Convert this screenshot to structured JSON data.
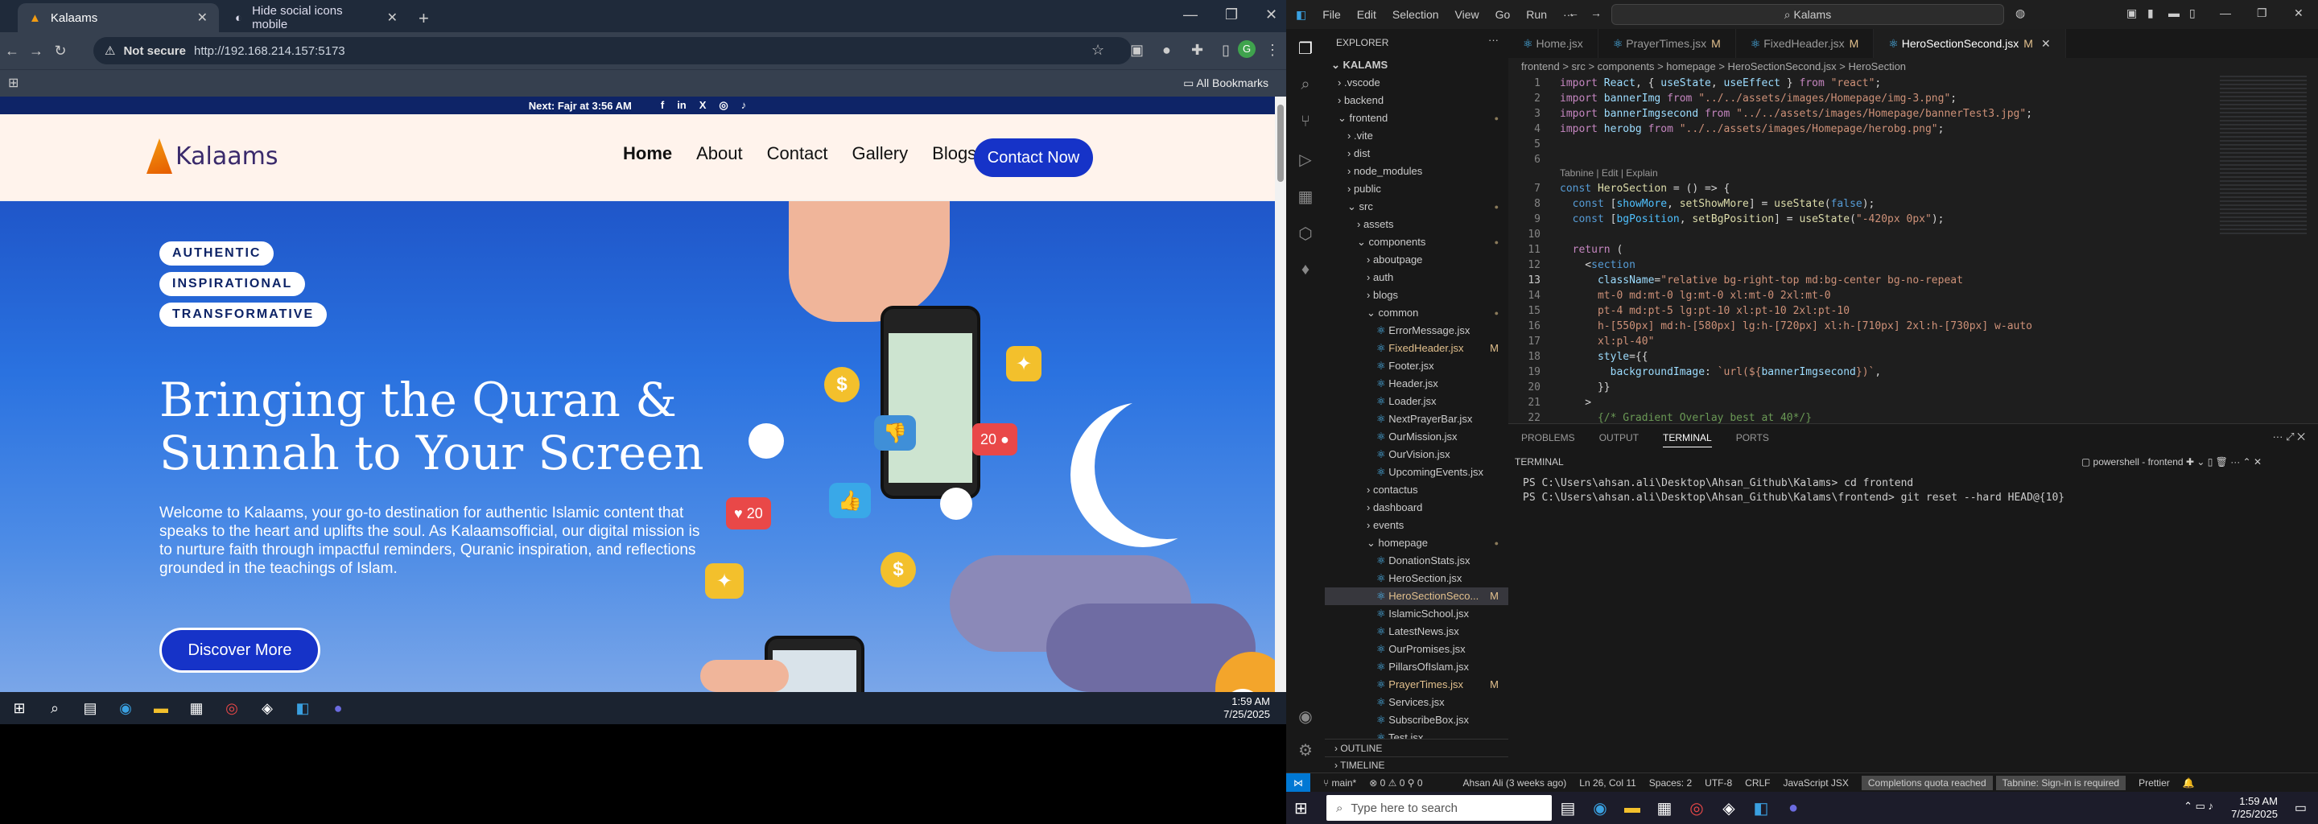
{
  "browser": {
    "tabs": [
      {
        "title": "Kalaams"
      },
      {
        "title": "Hide social icons mobile"
      }
    ],
    "new_tab": "+",
    "not_secure": "Not secure",
    "url": "http://192.168.214.157:5173",
    "all_bookmarks": "All Bookmarks"
  },
  "site": {
    "topbar_text": "Next: Fajr at 3:56 AM",
    "social": [
      "f",
      "in",
      "X",
      "◎",
      "♪"
    ],
    "logo_text": "Kalaams",
    "menu": [
      "Home",
      "About",
      "Contact",
      "Gallery",
      "Blogs"
    ],
    "contact_button": "Contact Now",
    "pills": [
      "AUTHENTIC",
      "INSPIRATIONAL",
      "TRANSFORMATIVE"
    ],
    "hero_title": "Bringing the Quran & Sunnah to Your Screen",
    "hero_para": "Welcome to Kalaams, your go-to destination for authentic Islamic content that speaks to the heart and uplifts the soul. As Kalaamsofficial, our digital mission is to nurture faith through impactful reminders, Quranic inspiration, and reflections grounded in the teachings of Islam.",
    "discover_button": "Discover More",
    "badges": {
      "comments": "20",
      "likes": "20",
      "coin": "$"
    }
  },
  "inner_taskbar": {
    "time": "1:59 AM",
    "date": "7/25/2025"
  },
  "vscode": {
    "menu": [
      "File",
      "Edit",
      "Selection",
      "View",
      "Go",
      "Run",
      "···"
    ],
    "search": "Kalams",
    "explorer_title": "EXPLORER",
    "root": "KALAMS",
    "tree": [
      {
        "label": ".vscode",
        "indent": 1,
        "folder": true
      },
      {
        "label": "backend",
        "indent": 1,
        "folder": true
      },
      {
        "label": "frontend",
        "indent": 1,
        "folder": true,
        "open": true,
        "dot": true
      },
      {
        "label": ".vite",
        "indent": 2,
        "folder": true
      },
      {
        "label": "dist",
        "indent": 2,
        "folder": true
      },
      {
        "label": "node_modules",
        "indent": 2,
        "folder": true
      },
      {
        "label": "public",
        "indent": 2,
        "folder": true
      },
      {
        "label": "src",
        "indent": 2,
        "folder": true,
        "open": true,
        "dot": true
      },
      {
        "label": "assets",
        "indent": 3,
        "folder": true
      },
      {
        "label": "components",
        "indent": 3,
        "folder": true,
        "open": true,
        "dot": true
      },
      {
        "label": "aboutpage",
        "indent": 4,
        "folder": true
      },
      {
        "label": "auth",
        "indent": 4,
        "folder": true
      },
      {
        "label": "blogs",
        "indent": 4,
        "folder": true
      },
      {
        "label": "common",
        "indent": 4,
        "folder": true,
        "open": true,
        "dot": true
      },
      {
        "label": "ErrorMessage.jsx",
        "indent": 5
      },
      {
        "label": "FixedHeader.jsx",
        "indent": 5,
        "mod": "M"
      },
      {
        "label": "Footer.jsx",
        "indent": 5
      },
      {
        "label": "Header.jsx",
        "indent": 5
      },
      {
        "label": "Loader.jsx",
        "indent": 5
      },
      {
        "label": "NextPrayerBar.jsx",
        "indent": 5
      },
      {
        "label": "OurMission.jsx",
        "indent": 5
      },
      {
        "label": "OurVision.jsx",
        "indent": 5
      },
      {
        "label": "UpcomingEvents.jsx",
        "indent": 5
      },
      {
        "label": "contactus",
        "indent": 4,
        "folder": true
      },
      {
        "label": "dashboard",
        "indent": 4,
        "folder": true
      },
      {
        "label": "events",
        "indent": 4,
        "folder": true
      },
      {
        "label": "homepage",
        "indent": 4,
        "folder": true,
        "open": true,
        "dot": true
      },
      {
        "label": "DonationStats.jsx",
        "indent": 5
      },
      {
        "label": "HeroSection.jsx",
        "indent": 5
      },
      {
        "label": "HeroSectionSeco...",
        "indent": 5,
        "mod": "M",
        "sel": true
      },
      {
        "label": "IslamicSchool.jsx",
        "indent": 5
      },
      {
        "label": "LatestNews.jsx",
        "indent": 5
      },
      {
        "label": "OurPromises.jsx",
        "indent": 5
      },
      {
        "label": "PillarsOfIslam.jsx",
        "indent": 5
      },
      {
        "label": "PrayerTimes.jsx",
        "indent": 5,
        "mod": "M"
      },
      {
        "label": "Services.jsx",
        "indent": 5
      },
      {
        "label": "SubscribeBox.jsx",
        "indent": 5
      },
      {
        "label": "Test.jsx",
        "indent": 5
      }
    ],
    "outline": "OUTLINE",
    "timeline": "TIMELINE",
    "editor_tabs": [
      {
        "label": "Home.jsx",
        "mod": ""
      },
      {
        "label": "PrayerTimes.jsx",
        "mod": "M"
      },
      {
        "label": "FixedHeader.jsx",
        "mod": "M"
      },
      {
        "label": "HeroSectionSecond.jsx",
        "mod": "M",
        "active": true
      }
    ],
    "breadcrumb": "frontend > src > components > homepage > HeroSectionSecond.jsx > HeroSection",
    "codelens": "Tabnine | Edit | Explain",
    "panel_tabs": [
      "PROBLEMS",
      "OUTPUT",
      "TERMINAL",
      "PORTS"
    ],
    "terminal_title": "TERMINAL",
    "terminal_shell": "powershell - frontend",
    "terminal_lines": [
      "PS C:\\Users\\ahsan.ali\\Desktop\\Ahsan_Github\\Kalams> cd frontend",
      "PS C:\\Users\\ahsan.ali\\Desktop\\Ahsan_Github\\Kalams\\frontend> git reset --hard HEAD@{10}"
    ],
    "status": {
      "branch": "main*",
      "errors": "⊗ 0 ⚠ 0 ⚲ 0",
      "blame": "Ahsan Ali (3 weeks ago)",
      "pos": "Ln 26, Col 11",
      "spaces": "Spaces: 2",
      "enc": "UTF-8",
      "eol": "CRLF",
      "lang": "JavaScript JSX",
      "quota": "Completions quota reached",
      "tabnine": "Tabnine: Sign-in is required",
      "prettier": "Prettier"
    }
  },
  "taskbar": {
    "search": "Type here to search",
    "time": "1:59 AM",
    "date": "7/25/2025"
  }
}
